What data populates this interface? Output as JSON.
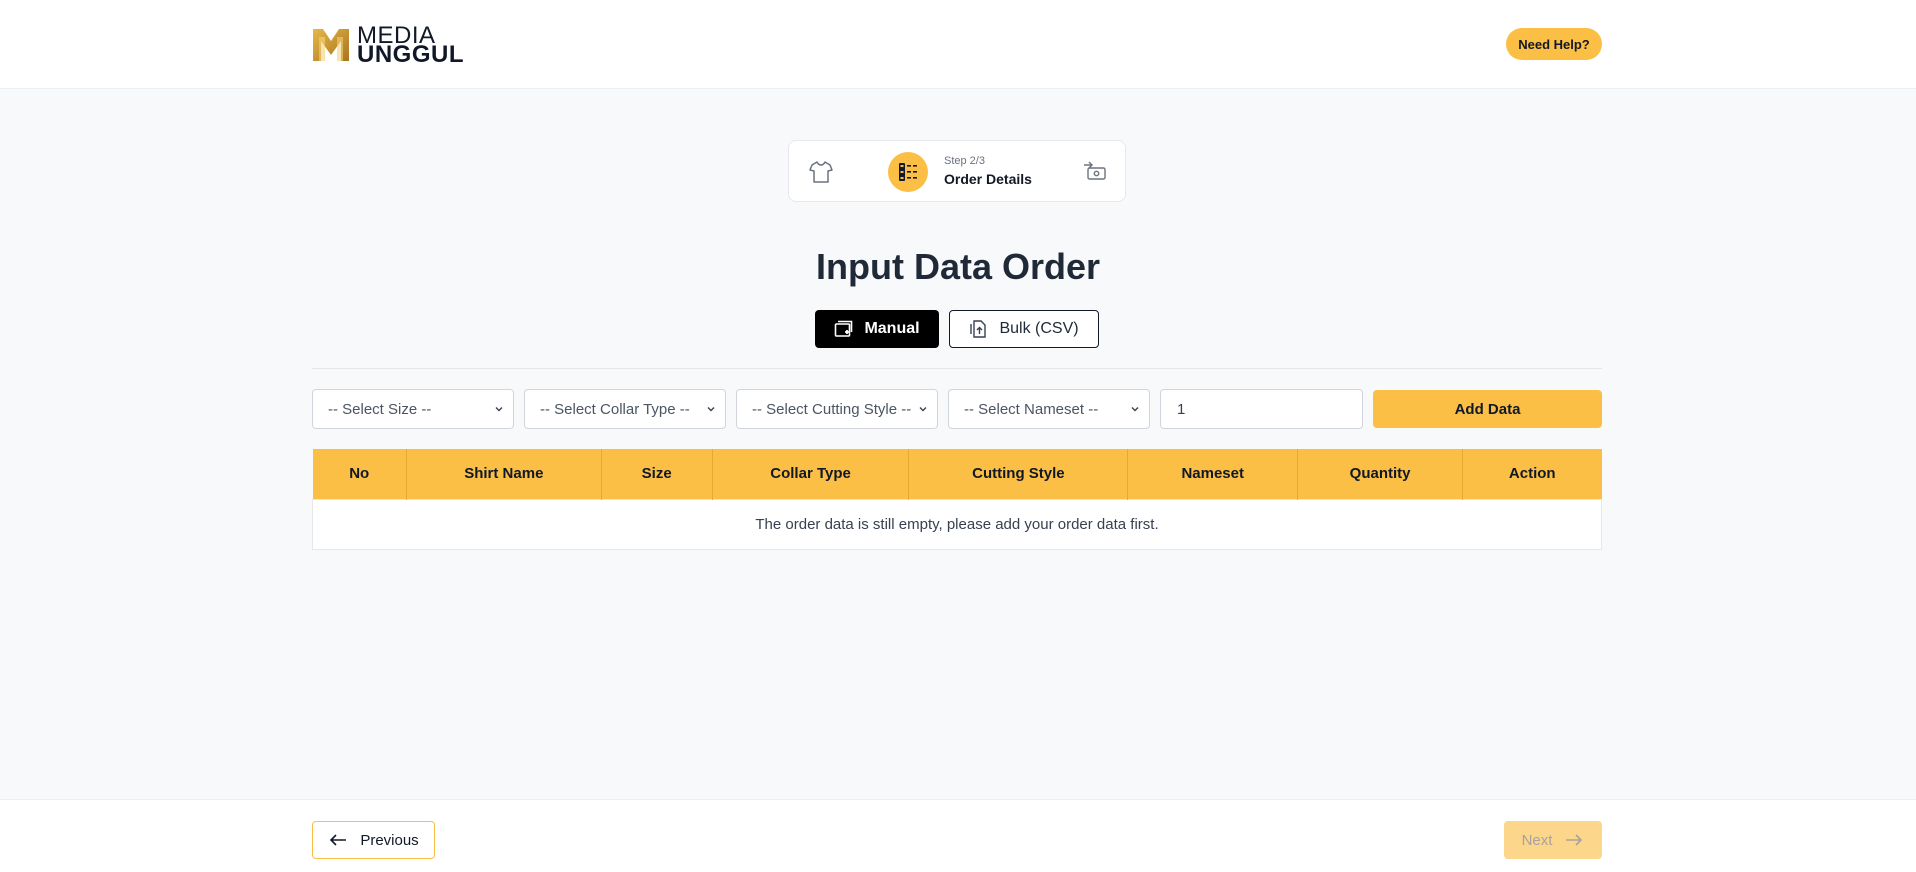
{
  "header": {
    "logo_line1": "MEDIA",
    "logo_line2": "UNGGUL",
    "help_label": "Need Help?"
  },
  "stepper": {
    "step_num": "Step 2/3",
    "step_name": "Order Details",
    "icons": [
      "shirt-icon",
      "order-list-icon",
      "payment-icon"
    ]
  },
  "page": {
    "title": "Input Data Order"
  },
  "mode_tabs": {
    "manual_label": "Manual",
    "bulk_label": "Bulk (CSV)",
    "active": "Manual"
  },
  "form": {
    "size_select": "-- Select Size --",
    "collar_select": "-- Select Collar Type --",
    "cutting_select": "-- Select Cutting Style --",
    "nameset_select": "-- Select Nameset --",
    "quantity_value": "1",
    "add_label": "Add Data"
  },
  "table": {
    "headers": [
      "No",
      "Shirt Name",
      "Size",
      "Collar Type",
      "Cutting Style",
      "Nameset",
      "Quantity",
      "Action"
    ],
    "empty_message": "The order data is still empty, please add your order data first."
  },
  "footer": {
    "prev_label": "Previous",
    "next_label": "Next"
  },
  "colors": {
    "accent": "#fbbf45",
    "accent_disabled": "#fcd68a",
    "background": "#f8f9fb"
  }
}
